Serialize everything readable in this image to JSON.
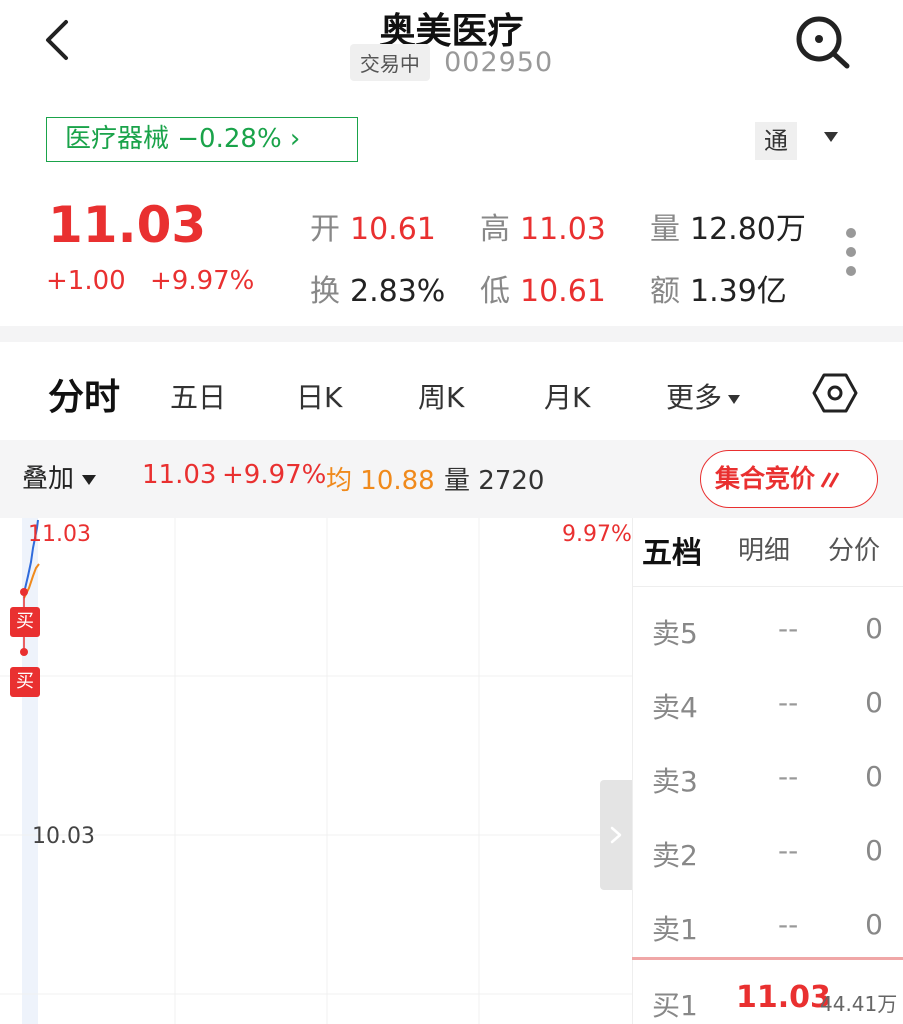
{
  "header": {
    "title": "奥美医疗",
    "status": "交易中",
    "code": "002950"
  },
  "sector": {
    "label": "医疗器械 −0.28%  ›",
    "color": "#1aa34a"
  },
  "tong": {
    "label": "通"
  },
  "quote": {
    "price": "11.03",
    "change": "+1.00",
    "change_pct": "+9.97%",
    "open_label": "开",
    "open": "10.61",
    "high_label": "高",
    "high": "11.03",
    "volume_label": "量",
    "volume": "12.80万",
    "turnover_label": "换",
    "turnover": "2.83%",
    "low_label": "低",
    "low": "10.61",
    "amount_label": "额",
    "amount": "1.39亿"
  },
  "tabs": [
    {
      "label": "分时",
      "active": true
    },
    {
      "label": "五日"
    },
    {
      "label": "日K"
    },
    {
      "label": "周K"
    },
    {
      "label": "月K"
    },
    {
      "label": "更多"
    }
  ],
  "infobar": {
    "overlay": "叠加",
    "price": "11.03",
    "pct": "+9.97%",
    "avg_label": "均",
    "avg": "10.88",
    "vol_label": "量",
    "vol": "2720",
    "auction": "集合竞价"
  },
  "chart": {
    "top_price": "11.03",
    "top_pct": "9.97%",
    "mid_price": "10.03",
    "buy_marker": "买"
  },
  "book": {
    "tabs": [
      "五档",
      "明细",
      "分价"
    ],
    "asks": [
      {
        "level": "卖5",
        "price": "--",
        "volume": "0"
      },
      {
        "level": "卖4",
        "price": "--",
        "volume": "0"
      },
      {
        "level": "卖3",
        "price": "--",
        "volume": "0"
      },
      {
        "level": "卖2",
        "price": "--",
        "volume": "0"
      },
      {
        "level": "卖1",
        "price": "--",
        "volume": "0"
      }
    ],
    "bid1": {
      "level": "买1",
      "price": "11.03",
      "volume": "44.41万"
    }
  },
  "colors": {
    "up": "#e93030",
    "down": "#1aa34a",
    "avg": "#f08a1c"
  }
}
